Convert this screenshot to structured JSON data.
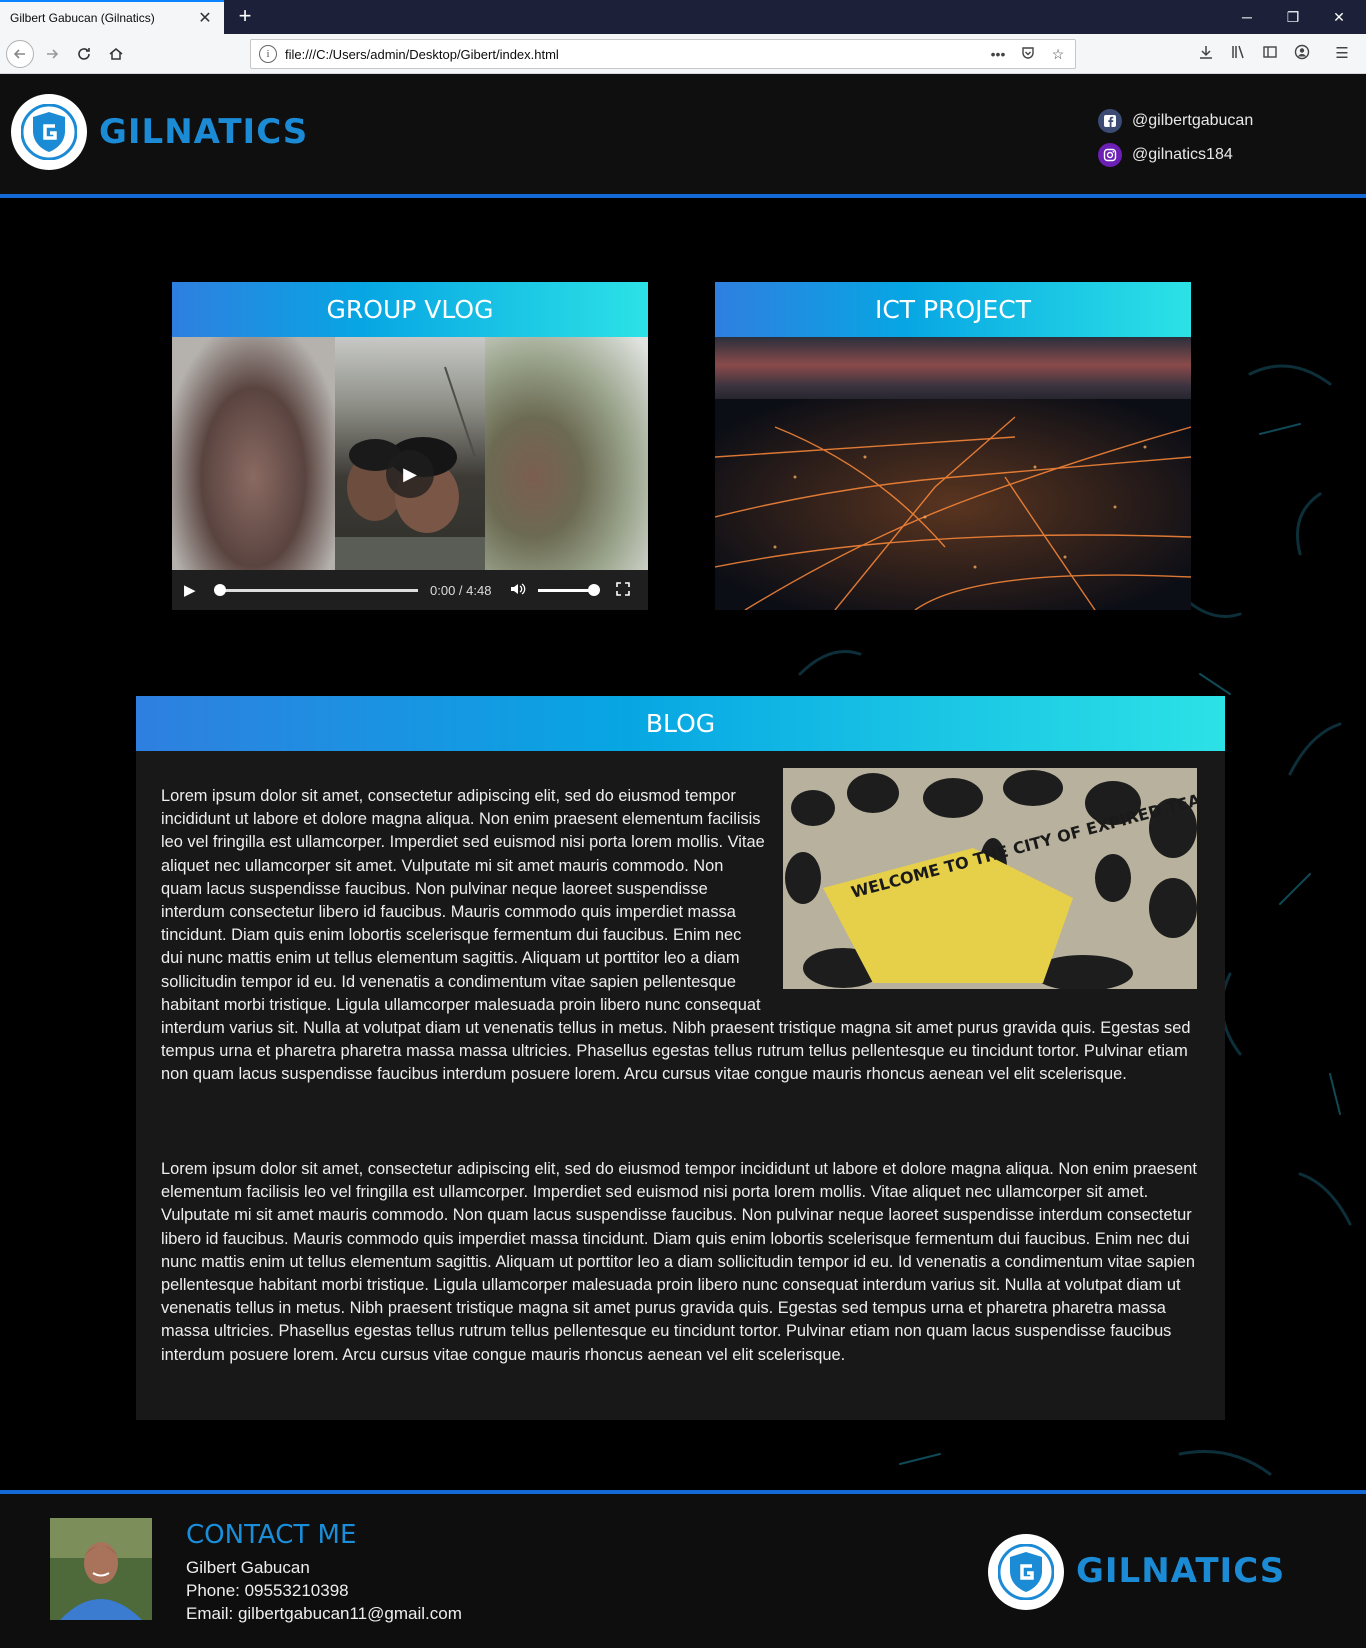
{
  "browser": {
    "tab_title": "Gilbert Gabucan (Gilnatics)",
    "tab_close": "✕",
    "new_tab": "+",
    "url": "file:///C:/Users/admin/Desktop/Gibert/index.html",
    "url_more": "•••"
  },
  "header": {
    "brand": "GILNATICS",
    "social": [
      {
        "network": "facebook",
        "handle": "@gilbertgabucan"
      },
      {
        "network": "instagram",
        "handle": "@gilnatics184"
      }
    ]
  },
  "cards": [
    {
      "title": "GROUP VLOG",
      "media": "video"
    },
    {
      "title": "ICT PROJECT",
      "media": "image"
    }
  ],
  "video": {
    "time": "0:00 / 4:48",
    "progress": 0,
    "volume": 1.0
  },
  "blog": {
    "title": "BLOG",
    "image_sign": "WELCOME TO THE CITY OF EXPIRED TEAR GAS",
    "p1": "Lorem ipsum dolor sit amet, consectetur adipiscing elit, sed do eiusmod tempor incididunt ut labore et dolore magna aliqua. Non enim praesent elementum facilisis leo vel fringilla est ullamcorper. Imperdiet sed euismod nisi porta lorem mollis. Vitae aliquet nec ullamcorper sit amet. Vulputate mi sit amet mauris commodo. Non quam lacus suspendisse faucibus. Non pulvinar neque laoreet suspendisse interdum consectetur libero id faucibus. Mauris commodo quis imperdiet massa tincidunt. Diam quis enim lobortis scelerisque fermentum dui faucibus. Enim nec dui nunc mattis enim ut tellus elementum sagittis. Aliquam ut porttitor leo a diam sollicitudin tempor id eu. Id venenatis a condimentum vitae sapien pellentesque habitant morbi tristique. Ligula ullamcorper malesuada proin libero nunc consequat interdum varius sit. Nulla at volutpat diam ut venenatis tellus in metus. Nibh praesent tristique magna sit amet purus gravida quis. Egestas sed tempus urna et pharetra pharetra massa massa ultricies. Phasellus egestas tellus rutrum tellus pellentesque eu tincidunt tortor. Pulvinar etiam non quam lacus suspendisse faucibus interdum posuere lorem. Arcu cursus vitae congue mauris rhoncus aenean vel elit scelerisque.",
    "p2": "Lorem ipsum dolor sit amet, consectetur adipiscing elit, sed do eiusmod tempor incididunt ut labore et dolore magna aliqua. Non enim praesent elementum facilisis leo vel fringilla est ullamcorper. Imperdiet sed euismod nisi porta lorem mollis. Vitae aliquet nec ullamcorper sit amet. Vulputate mi sit amet mauris commodo. Non quam lacus suspendisse faucibus. Non pulvinar neque laoreet suspendisse interdum consectetur libero id faucibus. Mauris commodo quis imperdiet massa tincidunt. Diam quis enim lobortis scelerisque fermentum dui faucibus. Enim nec dui nunc mattis enim ut tellus elementum sagittis. Aliquam ut porttitor leo a diam sollicitudin tempor id eu. Id venenatis a condimentum vitae sapien pellentesque habitant morbi tristique. Ligula ullamcorper malesuada proin libero nunc consequat interdum varius sit. Nulla at volutpat diam ut venenatis tellus in metus. Nibh praesent tristique magna sit amet purus gravida quis. Egestas sed tempus urna et pharetra pharetra massa massa ultricies. Phasellus egestas tellus rutrum tellus pellentesque eu tincidunt tortor. Pulvinar etiam non quam lacus suspendisse faucibus interdum posuere lorem. Arcu cursus vitae congue mauris rhoncus aenean vel elit scelerisque."
  },
  "footer": {
    "title": "CONTACT ME",
    "name": "Gilbert Gabucan",
    "phone": "Phone: 09553210398",
    "email": "Email: gilbertgabucan11@gmail.com",
    "brand": "GILNATICS"
  },
  "colors": {
    "accent": "#1b8bd6",
    "header_gradient": [
      "#2f7fe0",
      "#2ce2e6"
    ],
    "page_bg": "#000000"
  }
}
